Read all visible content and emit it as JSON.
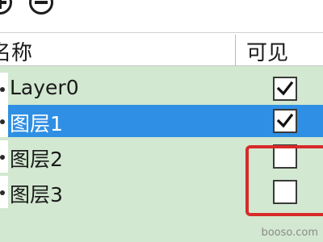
{
  "columns": {
    "name": "名称",
    "visible": "可见"
  },
  "layers": [
    {
      "name": "Layer0",
      "visible": true,
      "selected": false
    },
    {
      "name": "图层1",
      "visible": true,
      "selected": true
    },
    {
      "name": "图层2",
      "visible": false,
      "selected": false
    },
    {
      "name": "图层3",
      "visible": false,
      "selected": false
    }
  ],
  "colors": {
    "selection": "#2f8fe4",
    "background": "#d2e8d0",
    "highlight": "#d82a2a"
  },
  "watermark": "booso.com"
}
